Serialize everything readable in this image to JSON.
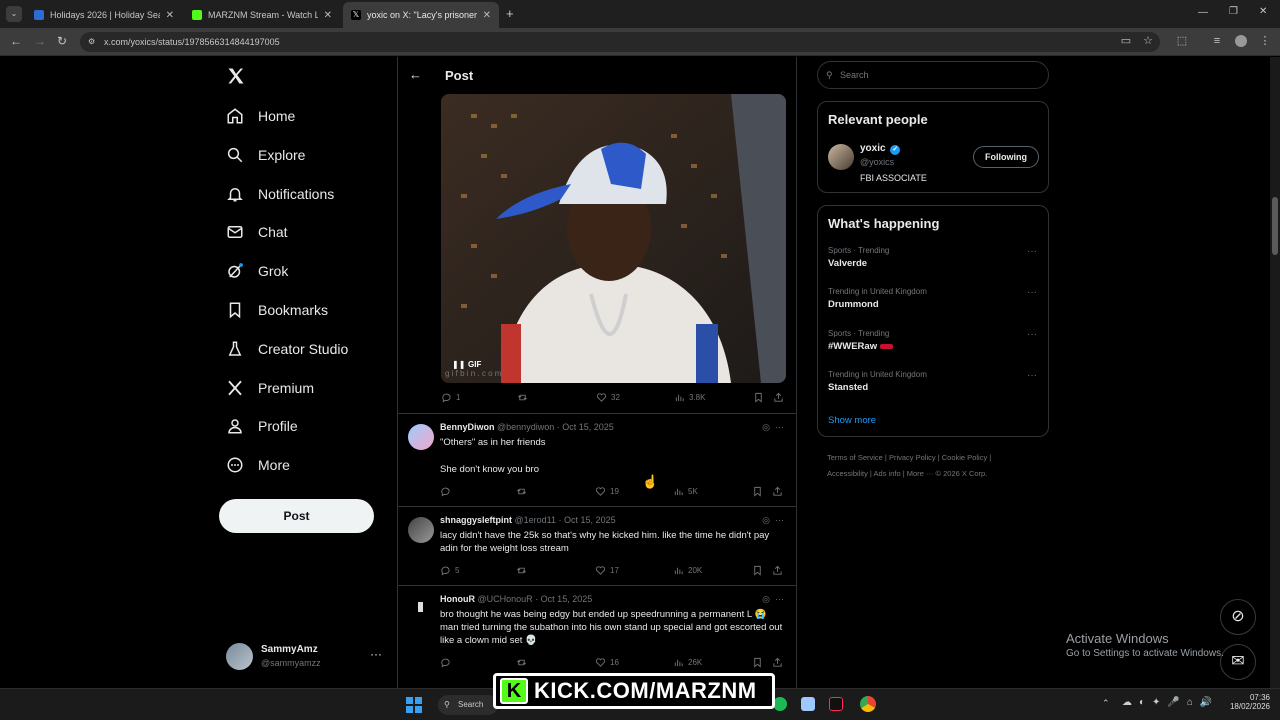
{
  "browser": {
    "tabs": [
      {
        "title": "Holidays 2026 | Holiday Search",
        "color": "#2d6bd6"
      },
      {
        "title": "MARZNM Stream - Watch Live",
        "color": "#53fc18"
      },
      {
        "title": "yoxic on X: \"Lacy's prisoner San",
        "color": "#000000",
        "active": true
      }
    ],
    "url": "x.com/yoxics/status/1978566314844197005",
    "add_tab": "+",
    "win_controls": [
      "—",
      "❐",
      "✕"
    ]
  },
  "nav": {
    "items": [
      {
        "label": "Home",
        "icon": "home-icon"
      },
      {
        "label": "Explore",
        "icon": "search-icon"
      },
      {
        "label": "Notifications",
        "icon": "bell-icon"
      },
      {
        "label": "Chat",
        "icon": "mail-icon"
      },
      {
        "label": "Grok",
        "icon": "grok-icon"
      },
      {
        "label": "Bookmarks",
        "icon": "bookmark-icon"
      },
      {
        "label": "Creator Studio",
        "icon": "flask-icon"
      },
      {
        "label": "Premium",
        "icon": "x-icon"
      },
      {
        "label": "Profile",
        "icon": "person-icon"
      },
      {
        "label": "More",
        "icon": "more-circle-icon"
      }
    ],
    "post_button": "Post",
    "account": {
      "name": "SammyAmz",
      "handle": "@sammyamzz"
    }
  },
  "center": {
    "header_title": "Post",
    "gif_badge": "GIF",
    "gif_watermark": "g i f b i n . c o m",
    "main_actions": {
      "replies": "1",
      "likes": "32",
      "views": "3.8K"
    },
    "replies": [
      {
        "name": "BennyDiwon",
        "handle": "@bennydiwon",
        "date": "· Oct 15, 2025",
        "lines": [
          "\"Others\" as in her friends",
          "She don't know you bro"
        ],
        "replies": "",
        "likes": "19",
        "views": "5K"
      },
      {
        "name": "shnaggysleftpint",
        "handle": "@1erod11",
        "date": "· Oct 15, 2025",
        "lines": [
          "lacy didn't have the 25k so that's why he kicked him. like the time he didn't pay adin for the weight loss stream"
        ],
        "replies": "5",
        "likes": "17",
        "views": "20K"
      },
      {
        "name": "HonouR",
        "handle": "@UCHonouR",
        "date": "· Oct 15, 2025",
        "lines": [
          "bro thought he was being edgy but ended up speedrunning a permanent L 😭 man tried turning the subathon into his own stand up special and got escorted out like a clown mid set 💀"
        ],
        "replies": "",
        "likes": "16",
        "views": "26K"
      }
    ]
  },
  "right": {
    "search_placeholder": "Search",
    "relevant_title": "Relevant people",
    "person": {
      "name": "yoxic",
      "handle": "@yoxics",
      "bio": "FBI ASSOCIATE",
      "follow_label": "Following"
    },
    "happening_title": "What's happening",
    "trends": [
      {
        "category": "Sports · Trending",
        "title": "Valverde"
      },
      {
        "category": "Trending in United Kingdom",
        "title": "Drummond"
      },
      {
        "category": "Sports · Trending",
        "title": "#WWERaw"
      },
      {
        "category": "Trending in United Kingdom",
        "title": "Stansted"
      }
    ],
    "show_more": "Show more",
    "footer_line1": "Terms of Service  |  Privacy Policy  |  Cookie Policy  |",
    "footer_line2": "Accessibility  |  Ads info  |  More ···  © 2026 X Corp."
  },
  "overlay": {
    "activate_title": "Activate Windows",
    "activate_sub": "Go to Settings to activate Windows.",
    "kick_text": "KICK.COM/MARZNM",
    "kick_k": "K"
  },
  "taskbar": {
    "search": "Search",
    "time": "07:36",
    "date": "18/02/2026"
  }
}
